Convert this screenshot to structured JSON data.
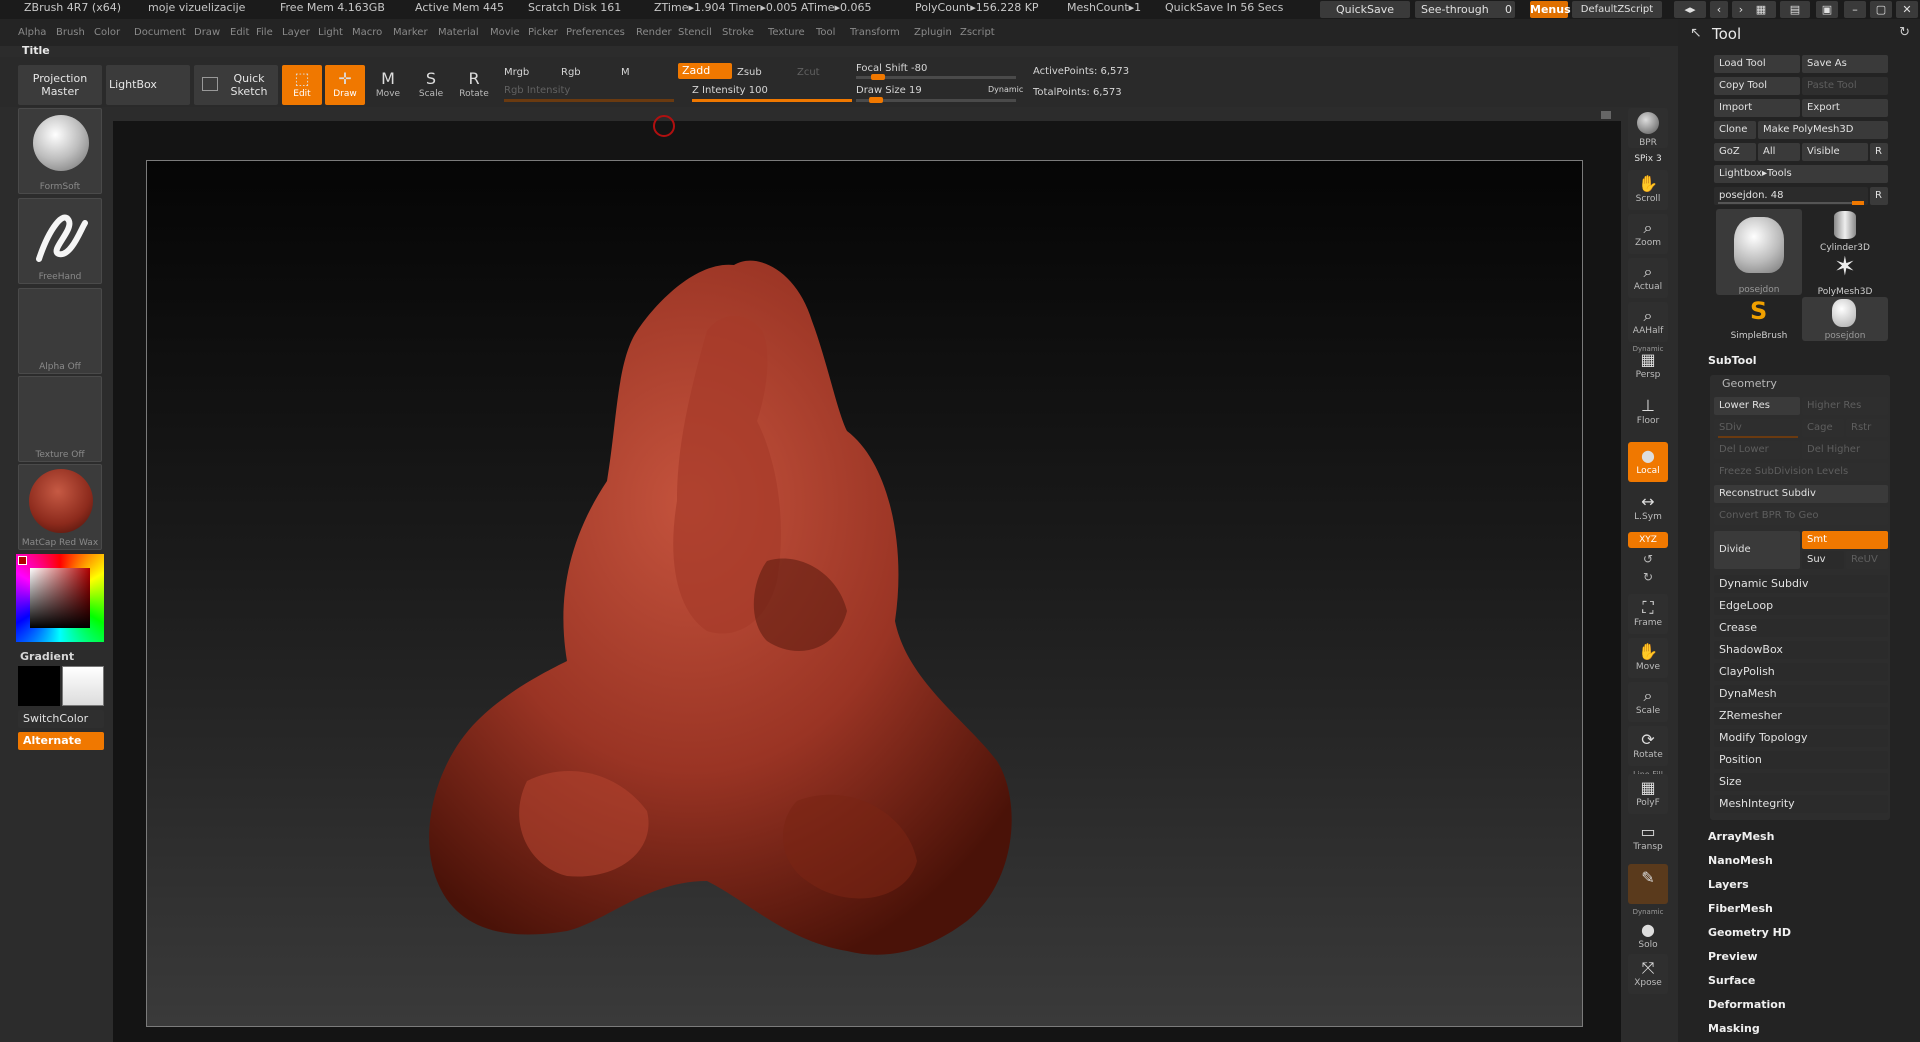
{
  "title_bar": {
    "app": "ZBrush 4R7 (x64)",
    "document": "moje vizuelizacije",
    "stats": [
      "Free Mem 4.163GB",
      "Active Mem 445",
      "Scratch Disk 161",
      "ZTime▸1.904 Timer▸0.005 ATime▸0.065",
      "PolyCount▸156.228 KP",
      "MeshCount▸1",
      "QuickSave In 56 Secs"
    ],
    "quicksave": "QuickSave",
    "seethrough": "See-through",
    "seethrough_value": "0",
    "menus": "Menus",
    "default_zscript": "DefaultZScript"
  },
  "menus": [
    "Alpha",
    "Brush",
    "Color",
    "Document",
    "Draw",
    "Edit",
    "File",
    "Layer",
    "Light",
    "Macro",
    "Marker",
    "Material",
    "Movie",
    "Picker",
    "Preferences",
    "Render",
    "Stencil",
    "Stroke",
    "Texture",
    "Tool",
    "Transform",
    "Zplugin",
    "Zscript"
  ],
  "strip_title": "Title",
  "toolbar": {
    "projection_master": "Projection Master",
    "lightbox": "LightBox",
    "quick_sketch": "Quick Sketch",
    "edit": "Edit",
    "draw": "Draw",
    "move": "Move",
    "scale": "Scale",
    "rotate": "Rotate",
    "mrgb": "Mrgb",
    "rgb": "Rgb",
    "m": "M",
    "zadd": "Zadd",
    "zsub": "Zsub",
    "zcut": "Zcut",
    "rgb_intensity": "Rgb Intensity",
    "z_intensity": "Z Intensity 100",
    "focal_shift": "Focal Shift -80",
    "draw_size": "Draw Size 19",
    "dynamic": "Dynamic",
    "active_points": "ActivePoints: 6,573",
    "total_points": "TotalPoints: 6,573",
    "z_intensity_level": 1.0,
    "focal_shift_value": -80,
    "draw_size_value": 19
  },
  "left_panel": {
    "brush": "FormSoft",
    "stroke": "FreeHand",
    "alpha": "Alpha Off",
    "texture": "Texture Off",
    "material": "MatCap Red Wax",
    "gradient": "Gradient",
    "switch_color": "SwitchColor",
    "alternate": "Alternate"
  },
  "right_shelf": [
    {
      "label": "BPR",
      "icon": "bpr-icon"
    },
    {
      "label": "SPix 3",
      "icon": ""
    },
    {
      "label": "Scroll",
      "icon": "scroll-icon"
    },
    {
      "label": "Zoom",
      "icon": "zoom-icon"
    },
    {
      "label": "Actual",
      "icon": "actual-icon"
    },
    {
      "label": "AAHalf",
      "icon": "aahalf-icon"
    },
    {
      "label": "Persp",
      "icon": "persp-icon"
    },
    {
      "label": "Floor",
      "icon": "floor-icon"
    },
    {
      "label": "Local",
      "icon": "local-icon"
    },
    {
      "label": "L.Sym",
      "icon": "lsym-icon"
    },
    {
      "label": "XYZ",
      "icon": "xyz-icon"
    },
    {
      "label": "Frame",
      "icon": "frame-icon"
    },
    {
      "label": "Move",
      "icon": "move-icon"
    },
    {
      "label": "Scale",
      "icon": "scale-icon"
    },
    {
      "label": "Rotate",
      "icon": "rotate-icon"
    },
    {
      "label": "PolyF",
      "icon": "polyf-icon"
    },
    {
      "label": "Transp",
      "icon": "transp-icon"
    },
    {
      "label": "Solo",
      "icon": "solo-icon"
    },
    {
      "label": "Xpose",
      "icon": "xpose-icon"
    }
  ],
  "right_shelf_extra": {
    "dynamic": "Dynamic",
    "line_fill": "Line Fill",
    "dynamic2": "Dynamic"
  },
  "tool_panel": {
    "title": "Tool",
    "load_tool": "Load Tool",
    "save_as": "Save As",
    "copy_tool": "Copy Tool",
    "paste_tool": "Paste Tool",
    "import": "Import",
    "export": "Export",
    "clone": "Clone",
    "make_polymesh": "Make PolyMesh3D",
    "goz": "GoZ",
    "all": "All",
    "visible": "Visible",
    "r": "R",
    "lightbox_tools": "Lightbox▸Tools",
    "current_tool": "posejdon. 48",
    "tiles": [
      "posejdon",
      "Cylinder3D",
      "PolyMesh3D",
      "SimpleBrush",
      "posejdon"
    ],
    "subtool": "SubTool",
    "geometry": "Geometry",
    "lower_res": "Lower Res",
    "higher_res": "Higher Res",
    "sdiv": "SDiv",
    "cage": "Cage",
    "rstr": "Rstr",
    "del_lower": "Del Lower",
    "del_higher": "Del Higher",
    "freeze": "Freeze SubDivision Levels",
    "reconstruct": "Reconstruct Subdiv",
    "convert_bpr": "Convert BPR To Geo",
    "divide": "Divide",
    "smt": "Smt",
    "suv": "Suv",
    "reuv": "ReUV",
    "geometry_items": [
      "Dynamic Subdiv",
      "EdgeLoop",
      "Crease",
      "ShadowBox",
      "ClayPolish",
      "DynaMesh",
      "ZRemesher",
      "Modify Topology",
      "Position",
      "Size",
      "MeshIntegrity"
    ],
    "sections": [
      "ArrayMesh",
      "NanoMesh",
      "Layers",
      "FiberMesh",
      "Geometry HD",
      "Preview",
      "Surface",
      "Deformation",
      "Masking"
    ]
  }
}
